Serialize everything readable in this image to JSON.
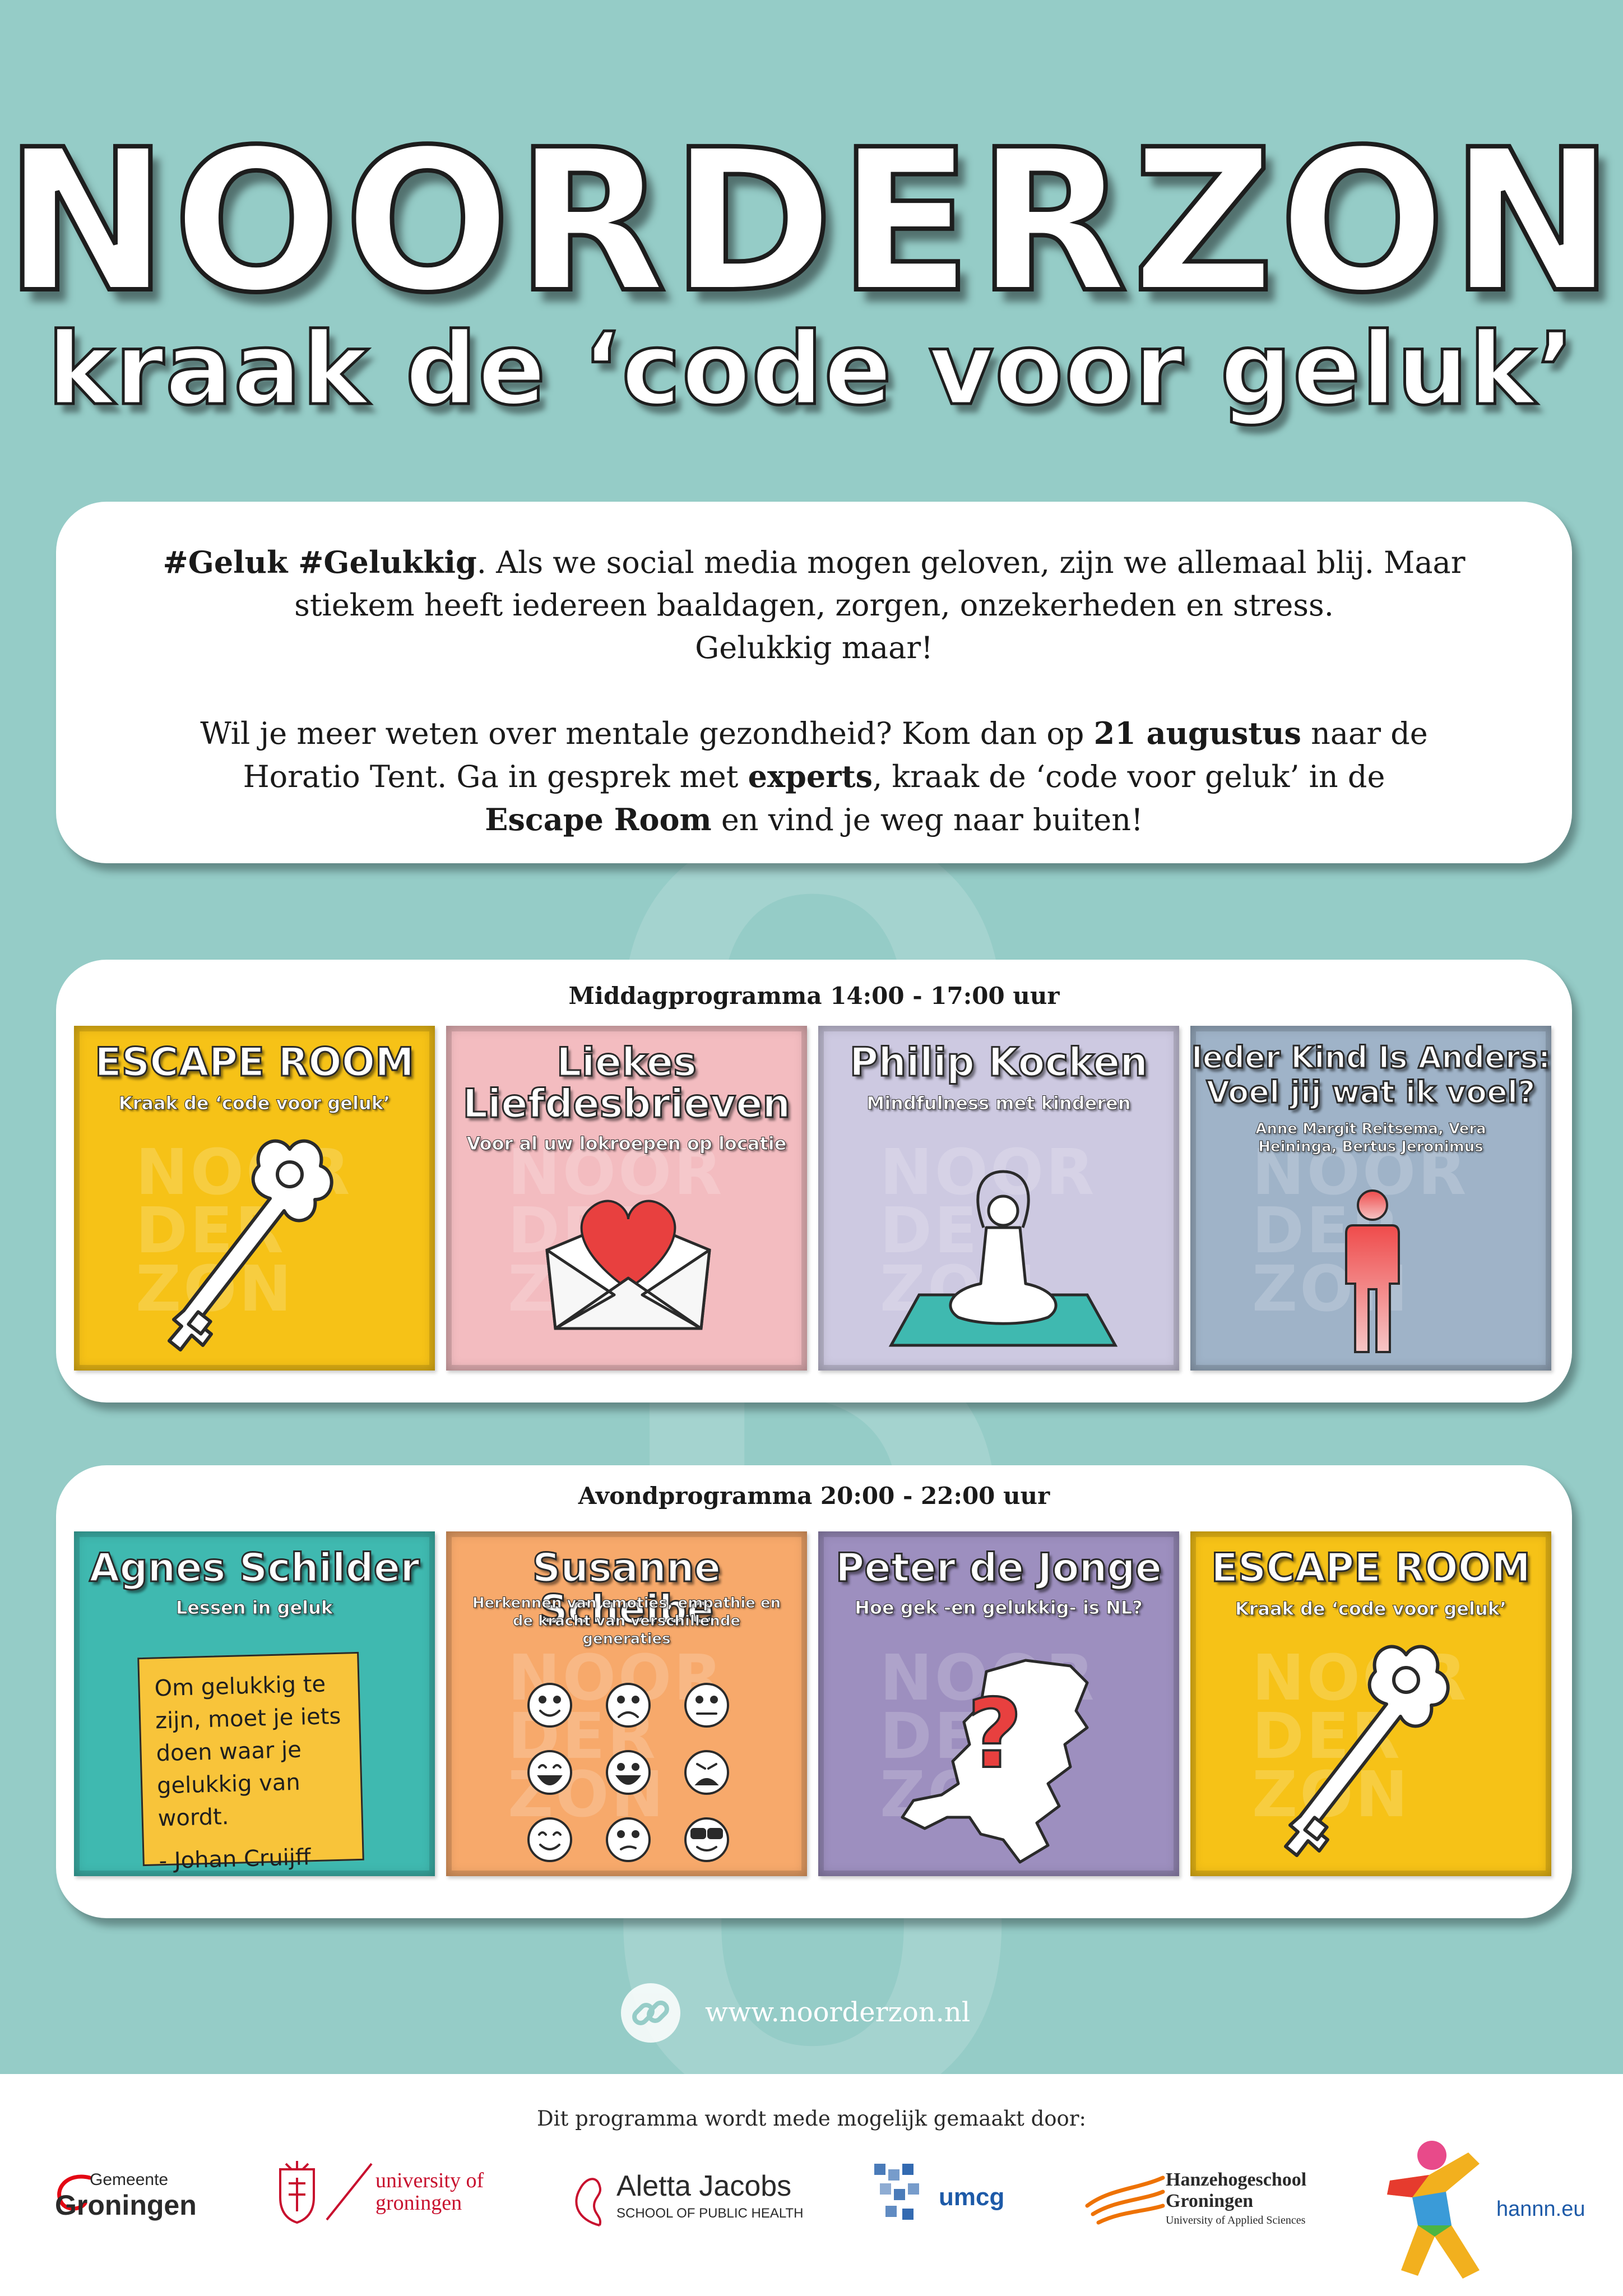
{
  "headline": "NOORDERZON",
  "subheadline": "kraak de ‘code voor geluk’",
  "watermark_letters": [
    "O",
    "R",
    "D",
    "E",
    "R",
    "Z",
    "O",
    "N"
  ],
  "intro": {
    "p1_bold": "#Geluk #Gelukkig",
    "p1_line1": ". Als we social media mogen geloven, zijn we allemaal blij. Maar",
    "p1_line2": "stiekem heeft iedereen baaldagen, zorgen, onzekerheden en stress.",
    "p1_line3": "Gelukkig maar!",
    "p2_a": "Wil je meer weten over mentale gezondheid? Kom dan op ",
    "p2_date": "21 augustus",
    "p2_b": " naar de",
    "p2_c": "Horatio Tent. Ga in gesprek met ",
    "p2_experts": "experts",
    "p2_d": ", kraak de ‘code voor geluk’ in de",
    "p2_escape": "Escape Room",
    "p2_e": " en vind je weg naar buiten!"
  },
  "tile_watermark": [
    "NOOR",
    "DER",
    "ZON"
  ],
  "afternoon": {
    "title": "Middagprogramma 14:00 - 17:00 uur",
    "tiles": [
      {
        "title": "ESCAPE ROOM",
        "subtitle": "Kraak de ‘code voor geluk’",
        "color": "#f6c217",
        "icon": "key-icon"
      },
      {
        "title_line1": "Liekes",
        "title_line2": "Liefdesbrieven",
        "subtitle": "Voor al uw lokroepen op locatie",
        "color": "#f3bcc0",
        "icon": "heart-envelope-icon"
      },
      {
        "title": "Philip Kocken",
        "subtitle": "Mindfulness met kinderen",
        "color": "#cdc9e1",
        "icon": "meditation-icon"
      },
      {
        "title_line1": "Ieder Kind Is Anders:",
        "title_line2": "Voel jij wat ik voel?",
        "note_line1": "Anne Margit Reitsema, Vera",
        "note_line2": "Heininga, Bertus Jeronimus",
        "color": "#9fb3c8",
        "icon": "person-icon"
      }
    ]
  },
  "evening": {
    "title": "Avondprogramma 20:00 - 22:00 uur",
    "tiles": [
      {
        "title": "Agnes Schilder",
        "subtitle": "Lessen in geluk",
        "quote_line1": "Om gelukkig te",
        "quote_line2": "zijn, moet je iets",
        "quote_line3": "doen waar je",
        "quote_line4": "gelukkig van wordt.",
        "quote_author": "- Johan Cruijff",
        "color": "#3fb9b0"
      },
      {
        "title": "Susanne Scheibe",
        "subtitle_line1": "Herkennen van emoties, empathie en",
        "subtitle_line2": "de kracht van verschillende",
        "subtitle_line3": "generaties",
        "color": "#f7a96b",
        "icon": "emoji-grid-icon"
      },
      {
        "title": "Peter de Jonge",
        "subtitle": "Hoe gek -en gelukkig- is NL?",
        "color": "#9d8fbf",
        "icon": "netherlands-question-icon"
      },
      {
        "title": "ESCAPE ROOM",
        "subtitle": "Kraak de ‘code voor geluk’",
        "color": "#f6c217",
        "icon": "key-icon"
      }
    ]
  },
  "link": {
    "url": "www.noorderzon.nl",
    "icon": "link-icon"
  },
  "footer": {
    "title": "Dit programma wordt mede mogelijk gemaakt door:",
    "gemeente_small": "Gemeente",
    "gemeente_big": "Groningen",
    "rug_line1": "university of",
    "rug_line2": "groningen",
    "aletta_line1": "Aletta Jacobs",
    "aletta_line2": "SCHOOL OF PUBLIC HEALTH",
    "umcg": "umcg",
    "hanze_line1": "Hanzehogeschool",
    "hanze_line2": "Groningen",
    "hanze_line3": "University of Applied Sciences",
    "hannn": "hannn.eu"
  }
}
